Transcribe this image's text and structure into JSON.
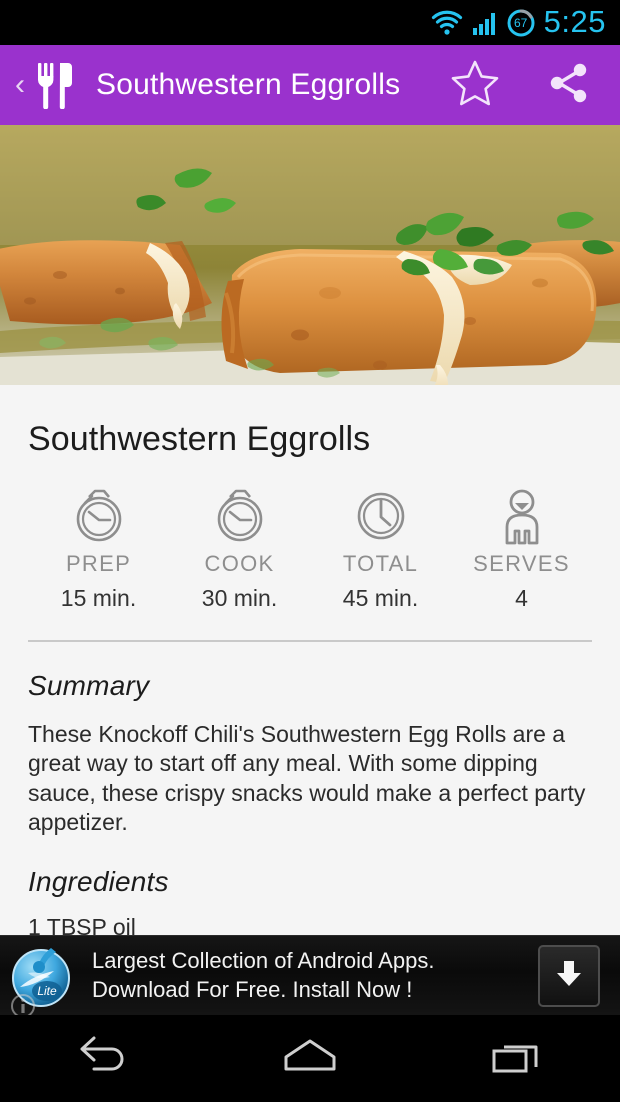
{
  "status_bar": {
    "wifi_icon": "wifi-icon",
    "signal_icon": "cellular-signal-icon",
    "battery_level": "67",
    "time": "5:25",
    "accent_color": "#26c3ef"
  },
  "app_bar": {
    "back_label": "‹",
    "app_icon": "fork-and-knife-icon",
    "title": "Southwestern Eggrolls",
    "favorite_icon": "star-outline-icon",
    "share_icon": "share-icon",
    "background_color": "#9a32cd"
  },
  "hero": {
    "image_alt": "southwestern-eggrolls-photo"
  },
  "recipe": {
    "title": "Southwestern Eggrolls",
    "meta": [
      {
        "label": "PREP",
        "value": "15 min.",
        "icon": "stopwatch-icon"
      },
      {
        "label": "COOK",
        "value": "30 min.",
        "icon": "stopwatch-icon"
      },
      {
        "label": "TOTAL",
        "value": "45 min.",
        "icon": "clock-icon"
      },
      {
        "label": "SERVES",
        "value": "4",
        "icon": "person-icon"
      }
    ],
    "summary_heading": "Summary",
    "summary_text": "These Knockoff Chili's Southwestern Egg Rolls are a great way to start off any meal. With some dipping sauce, these crispy snacks would make a perfect party appetizer.",
    "ingredients_heading": "Ingredients",
    "ingredients": [
      "1 TBSP oil"
    ]
  },
  "ad": {
    "logo_icon": "lite-app-logo-icon",
    "logo_badge": "Lite",
    "line1": "Largest Collection of Android Apps.",
    "line2": "Download For Free. Install Now !",
    "cta_icon": "download-arrow-icon",
    "info_icon": "ad-info-icon"
  },
  "nav_bar": {
    "back_icon": "nav-back-icon",
    "home_icon": "nav-home-icon",
    "recents_icon": "nav-recents-icon"
  }
}
